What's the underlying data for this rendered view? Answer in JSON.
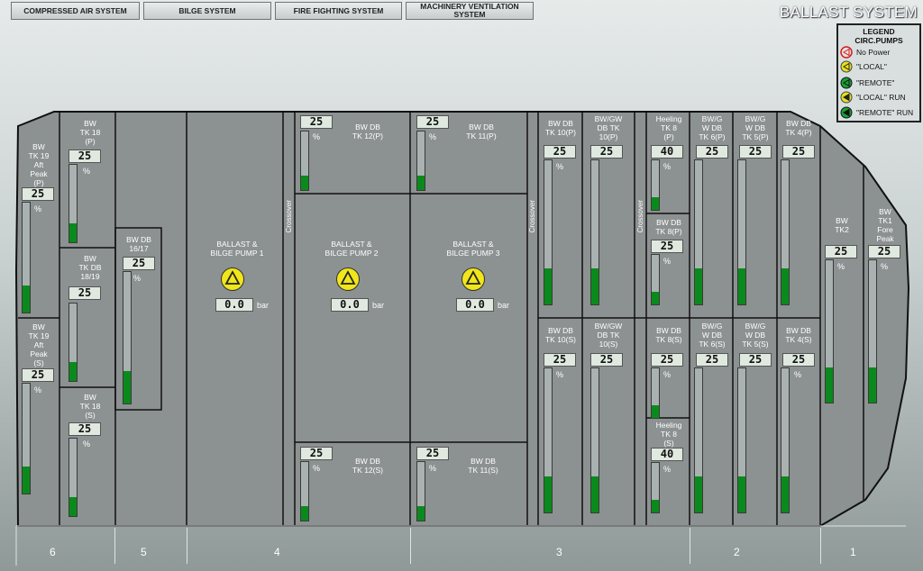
{
  "nav": [
    "COMPRESSED AIR SYSTEM",
    "BILGE  SYSTEM",
    "FIRE FIGHTING  SYSTEM",
    "MACHINERY VENTILATION SYSTEM"
  ],
  "title": "BALLAST SYSTEM",
  "legend": {
    "title": "LEGEND\nCIRC.PUMPS",
    "items": [
      {
        "label": "No Power",
        "color": "#e8c3c3",
        "ring": "#cc2222",
        "icon": "triangle-outline-icon"
      },
      {
        "label": "\"LOCAL\"",
        "color": "#e6e020",
        "ring": "#555",
        "icon": "triangle-yellow-icon"
      },
      {
        "label": "\"REMOTE\"",
        "color": "#19a031",
        "ring": "#113",
        "icon": "triangle-green-icon"
      },
      {
        "label": "\"LOCAL\" RUN",
        "color": "#e6e020",
        "ring": "#555",
        "icon": "triangle-yellow-run-icon"
      },
      {
        "label": "\"REMOTE\" RUN",
        "color": "#19a031",
        "ring": "#113",
        "icon": "triangle-green-run-icon"
      }
    ]
  },
  "pumps": [
    {
      "label": "BALLAST &\nBILGE PUMP 1",
      "value": "0.0",
      "unit": "bar"
    },
    {
      "label": "BALLAST &\nBILGE PUMP 2",
      "value": "0.0",
      "unit": "bar"
    },
    {
      "label": "BALLAST &\nBILGE PUMP 3",
      "value": "0.0",
      "unit": "bar"
    }
  ],
  "crossover": "Crossover",
  "tanks": {
    "t19p": {
      "label": "BW\nTK 19\nAft\nPeak\n(P)",
      "value": "25",
      "level": 25
    },
    "t19s": {
      "label": "BW\nTK 19\nAft\nPeak\n(S)",
      "value": "25",
      "level": 25
    },
    "t18p": {
      "label": "BW\nTK 18\n(P)",
      "value": "25",
      "level": 25
    },
    "t1819": {
      "label": "BW\nTK DB\n18/19",
      "value": "25",
      "level": 25
    },
    "t18s": {
      "label": "BW\nTK 18\n(S)",
      "value": "25",
      "level": 25
    },
    "t1617": {
      "label": "BW DB\n16/17",
      "value": "25",
      "level": 25
    },
    "t12p": {
      "label": "BW DB\nTK 12(P)",
      "value": "25",
      "level": 25
    },
    "t11p": {
      "label": "BW DB\nTK 11(P)",
      "value": "25",
      "level": 25
    },
    "t12s": {
      "label": "BW DB\nTK 12(S)",
      "value": "25",
      "level": 25
    },
    "t11s": {
      "label": "BW DB\nTK 11(S)",
      "value": "25",
      "level": 25
    },
    "t10p": {
      "label": "BW DB\nTK 10(P)",
      "value": "25",
      "level": 25
    },
    "t10gp": {
      "label": "BW/GW\nDB TK\n10(P)",
      "value": "25",
      "level": 25
    },
    "t10s": {
      "label": "BW DB\nTK 10(S)",
      "value": "25",
      "level": 25
    },
    "t10gs": {
      "label": "BW/GW\nDB TK\n10(S)",
      "value": "25",
      "level": 25
    },
    "h8p": {
      "label": "Heeling\nTK 8\n(P)",
      "value": "40",
      "level": 25
    },
    "t8p": {
      "label": "BW DB\nTK 8(P)",
      "value": "25",
      "level": 25
    },
    "t8s": {
      "label": "BW DB\nTK 8(S)",
      "value": "25",
      "level": 25
    },
    "h8s": {
      "label": "Heeling\nTK 8\n(S)",
      "value": "40",
      "level": 25
    },
    "t6p": {
      "label": "BW/G\nW DB\nTK 6(P)",
      "value": "25",
      "level": 25
    },
    "t5p": {
      "label": "BW/G\nW DB\nTK 5(P)",
      "value": "25",
      "level": 25
    },
    "t4p": {
      "label": "BW DB\nTK 4(P)",
      "value": "25",
      "level": 25
    },
    "t6s": {
      "label": "BW/G\nW DB\nTK 6(S)",
      "value": "25",
      "level": 25
    },
    "t5s": {
      "label": "BW/G\nW DB\nTK 5(S)",
      "value": "25",
      "level": 25
    },
    "t4s": {
      "label": "BW DB\nTK 4(S)",
      "value": "25",
      "level": 25
    },
    "tk2": {
      "label": "BW\nTK2",
      "value": "25",
      "level": 25
    },
    "tk1": {
      "label": "BW\nTK1\nFore\nPeak",
      "value": "25",
      "level": 25
    }
  },
  "percent_sign": "%",
  "zones": [
    "6",
    "5",
    "4",
    "3",
    "2",
    "1"
  ]
}
